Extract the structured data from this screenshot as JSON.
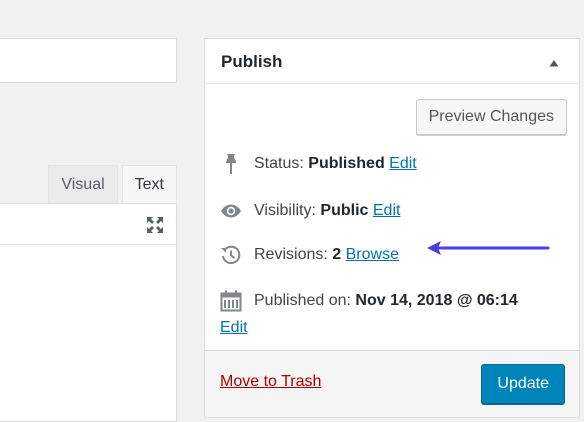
{
  "editor": {
    "tabs": [
      {
        "label": "Visual",
        "active": false
      },
      {
        "label": "Text",
        "active": true
      }
    ],
    "fullscreen_icon": "fullscreen-expand-icon"
  },
  "publish": {
    "title": "Publish",
    "toggle_icon": "triangle-up-icon",
    "preview_label": "Preview Changes",
    "status": {
      "icon": "pin-icon",
      "label": "Status:",
      "value": "Published",
      "link": "Edit"
    },
    "visibility": {
      "icon": "eye-icon",
      "label": "Visibility:",
      "value": "Public",
      "link": "Edit"
    },
    "revisions": {
      "icon": "history-icon",
      "label": "Revisions:",
      "value": "2",
      "link": "Browse"
    },
    "published_on": {
      "icon": "calendar-icon",
      "label": "Published on:",
      "value": "Nov 14, 2018 @ 06:14",
      "link": "Edit"
    },
    "trash_label": "Move to Trash",
    "update_label": "Update"
  },
  "colors": {
    "link": "#0073aa",
    "trash": "#a00000",
    "primary_button": "#0085ba",
    "annotation_arrow": "#4a3fe0"
  }
}
